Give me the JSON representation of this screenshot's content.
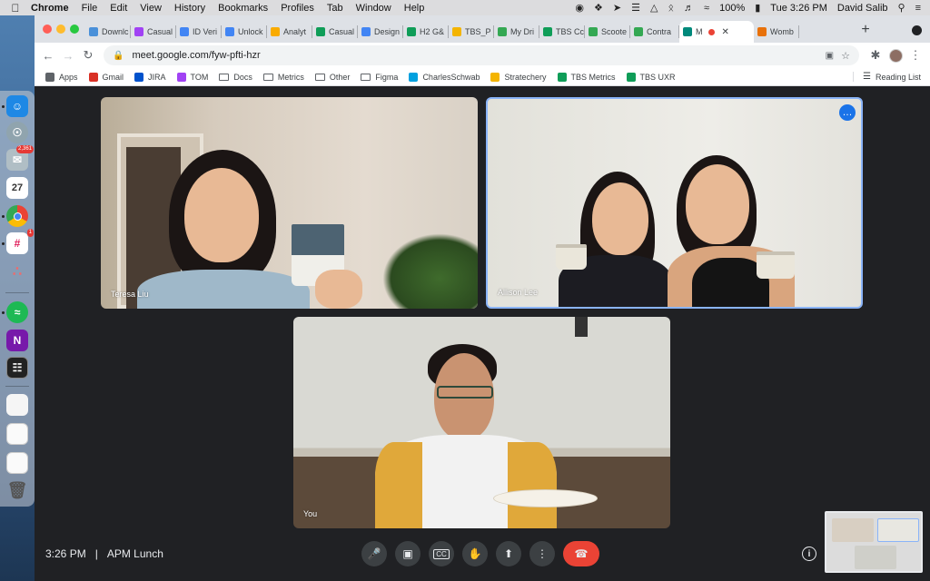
{
  "menubar": {
    "app": "Chrome",
    "items": [
      "File",
      "Edit",
      "View",
      "History",
      "Bookmarks",
      "Profiles",
      "Tab",
      "Window",
      "Help"
    ],
    "battery": "100%",
    "clock": "Tue 3:26 PM",
    "user": "David Salib"
  },
  "tabs": [
    {
      "label": "Downlc",
      "color": "#4a90d9"
    },
    {
      "label": "Casual",
      "color": "#a142f4"
    },
    {
      "label": "ID Veri",
      "color": "#4285f4"
    },
    {
      "label": "Unlock",
      "color": "#4285f4"
    },
    {
      "label": "Analyt",
      "color": "#f9ab00"
    },
    {
      "label": "Casual",
      "color": "#0f9d58"
    },
    {
      "label": "Design",
      "color": "#4285f4"
    },
    {
      "label": "H2 G&",
      "color": "#0f9d58"
    },
    {
      "label": "TBS_P",
      "color": "#f4b400"
    },
    {
      "label": "My Dri",
      "color": "#34a853"
    },
    {
      "label": "TBS Cc",
      "color": "#0f9d58"
    },
    {
      "label": "Scoote",
      "color": "#34a853"
    },
    {
      "label": "Contra",
      "color": "#34a853"
    },
    {
      "label": "M",
      "color": "#00897b"
    },
    {
      "label": "Womb",
      "color": "#e8710a"
    }
  ],
  "omnibox": {
    "url": "meet.google.com/fyw-pfti-hzr"
  },
  "bookmarks": [
    {
      "label": "Apps",
      "icon": "apps-icon",
      "color": "#5f6368"
    },
    {
      "label": "Gmail",
      "icon": "gmail-icon",
      "color": "#d93025"
    },
    {
      "label": "JIRA",
      "icon": "jira-icon",
      "color": "#0052cc"
    },
    {
      "label": "TOM",
      "icon": "tom-icon",
      "color": "#a142f4"
    },
    {
      "label": "Docs",
      "icon": "folder-icon",
      "color": ""
    },
    {
      "label": "Metrics",
      "icon": "folder-icon",
      "color": ""
    },
    {
      "label": "Other",
      "icon": "folder-icon",
      "color": ""
    },
    {
      "label": "Figma",
      "icon": "folder-icon",
      "color": ""
    },
    {
      "label": "CharlesSchwab",
      "icon": "schwab-icon",
      "color": "#00a0df"
    },
    {
      "label": "Stratechery",
      "icon": "stratechery-icon",
      "color": "#f4b400"
    },
    {
      "label": "TBS Metrics",
      "icon": "sheets-icon",
      "color": "#0f9d58"
    },
    {
      "label": "TBS UXR",
      "icon": "sheets-icon",
      "color": "#0f9d58"
    }
  ],
  "reading_list": "Reading List",
  "participants": {
    "tile1": "Teresa Liu",
    "tile2": "Allison Lee",
    "tile3": "You"
  },
  "meeting": {
    "time": "3:26 PM",
    "separator": "|",
    "name": "APM Lunch"
  },
  "dock_badges": {
    "mail": "2,361",
    "calendar_day": "27",
    "slack": "1"
  }
}
